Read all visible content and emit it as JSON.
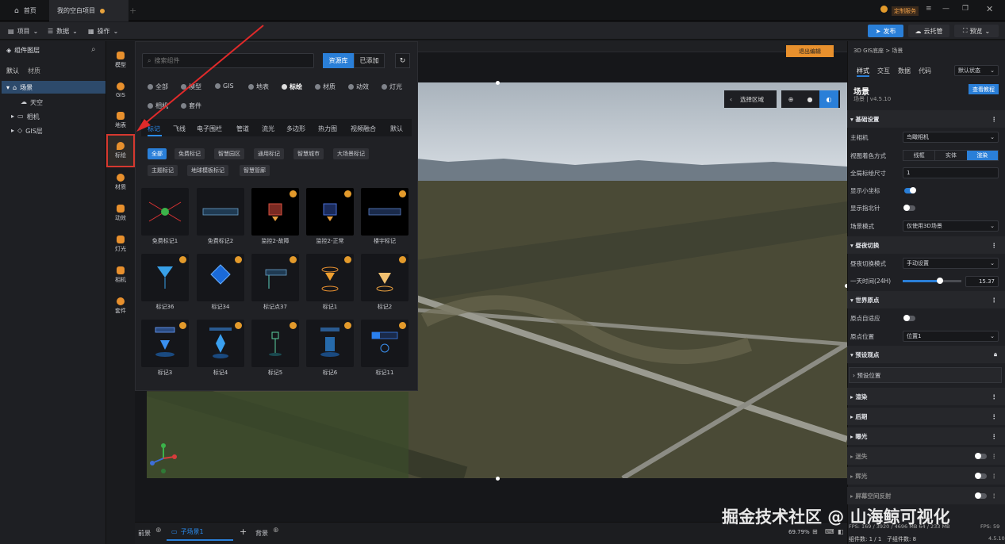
{
  "titlebar": {
    "home_tab": "首页",
    "project_tab": "我的空白项目",
    "custom_service": "定制服务"
  },
  "toolbar": {
    "project": "项目",
    "data": "数据",
    "ops": "操作",
    "publish": "发布",
    "cloud": "云托管",
    "preview": "预览"
  },
  "layers": {
    "title": "组件图层",
    "tab_default": "默认",
    "tab_material": "材质",
    "items": [
      "场景",
      "天空",
      "相机",
      "GIS层"
    ]
  },
  "iconbar": [
    "模型",
    "GIS",
    "地表",
    "标绘",
    "材质",
    "动效",
    "灯光",
    "相机",
    "套件"
  ],
  "popup": {
    "search_placeholder": "搜索组件",
    "btn_library": "资源库",
    "btn_added": "已添加",
    "cats": [
      "全部",
      "模型",
      "GIS",
      "地表",
      "标绘",
      "材质",
      "动效",
      "灯光",
      "相机",
      "套件"
    ],
    "subtabs": [
      "标记",
      "飞线",
      "电子围栏",
      "管道",
      "流光",
      "多边形",
      "热力图",
      "视频融合",
      "默认"
    ],
    "chips": [
      "全部",
      "免费标记",
      "智慧园区",
      "通用标记",
      "智慧城市",
      "大场景标记",
      "主题标记",
      "地球模板标记",
      "智慧管廊"
    ],
    "cards": [
      "免费标记1",
      "免费标记2",
      "监控2-故障",
      "监控2-正常",
      "楼宇标记",
      "标记36",
      "标记34",
      "标记点37",
      "标记1",
      "标记2",
      "标记3",
      "标记4",
      "标记5",
      "标记6",
      "标记11"
    ]
  },
  "canvas": {
    "exit_edit": "退出编辑",
    "select_area": "选择区域"
  },
  "right": {
    "breadcrumb": "3D GIS底座 > 场景",
    "tabs": [
      "样式",
      "交互",
      "数据",
      "代码"
    ],
    "default_state": "默认状态",
    "scene_title": "场景",
    "scene_version": "场景 | v4.5.10",
    "tutorial": "查看教程",
    "basic": "基础设置",
    "main_camera": "主相机",
    "main_camera_val": "鸟瞰相机",
    "view_color": "视图着色方式",
    "view_opts": [
      "线框",
      "实体",
      "渲染"
    ],
    "global_size": "全局标绘尺寸",
    "global_size_val": "1",
    "show_coord": "显示小坐标",
    "show_compass": "显示指北针",
    "scene_mode": "场景模式",
    "scene_mode_val": "仅使用3D场景",
    "daynight": "昼夜切换",
    "daynight_mode": "昼夜切换模式",
    "daynight_mode_val": "手动设置",
    "time_label": "一天时间(24H)",
    "time_val": "15.37",
    "time_fraction": 0.64,
    "world_origin": "世界原点",
    "origin_adapt": "原点自适应",
    "origin_pos": "原点位置",
    "origin_pos_val": "位置1",
    "preset_view": "预设观点",
    "preset_pos": "预设位置",
    "render": "渲染",
    "post": "后期",
    "exposure": "曝光",
    "fog": "迷失",
    "glow": "辉光",
    "ssr": "屏幕空间反射"
  },
  "bottom": {
    "front": "前景",
    "sub_scene": "子场景1",
    "back": "背景",
    "zoom": "69.79%",
    "stats": "FPS: 169 / 3920 / 4696 MB  64 / 233 MB",
    "fps": "FPS: 59",
    "count": "组件数: 1 / 1",
    "sub_count": "子组件数: 8",
    "version": "4.5.10"
  },
  "watermark": "掘金技术社区 @ 山海鲸可视化"
}
